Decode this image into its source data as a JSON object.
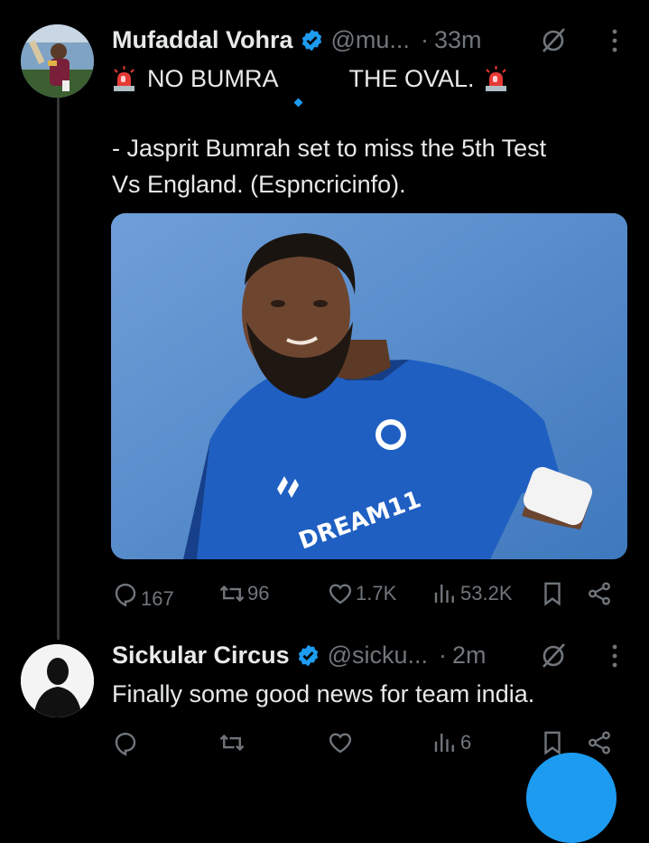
{
  "colors": {
    "background": "#000000",
    "text": "#e7e9ea",
    "secondary": "#71767b",
    "accent": "#1d9bf0",
    "thread_line": "#333639"
  },
  "tweets": [
    {
      "display_name": "Mufaddal Vohra",
      "handle": "@mu...",
      "separator": "·",
      "timestamp": "33m",
      "text_line1_a": "NO BUMRA",
      "text_line1_b": "THE OVAL.",
      "text_line2": "- Jasprit Bumrah set to miss the 5th Test",
      "text_line3": "Vs England. (Espncricinfo).",
      "media_jersey_text": "DREAM11",
      "actions": {
        "replies": "167",
        "reposts": "96",
        "likes": "1.7K",
        "views": "53.2K"
      }
    },
    {
      "display_name": "Sickular Circus",
      "handle": "@sicku...",
      "separator": "·",
      "timestamp": "2m",
      "text": "Finally some good news for team india.",
      "actions": {
        "replies": "",
        "reposts": "",
        "likes": "",
        "views": "6"
      }
    }
  ],
  "icons": {
    "verified": "verified-badge-icon",
    "grok": "grok-icon",
    "more": "more-vertical-icon",
    "siren": "siren-emoji-icon",
    "reply": "reply-icon",
    "repost": "repost-icon",
    "like": "heart-icon",
    "views": "views-icon",
    "bookmark": "bookmark-icon",
    "share": "share-icon",
    "compose": "compose-fab-icon"
  }
}
